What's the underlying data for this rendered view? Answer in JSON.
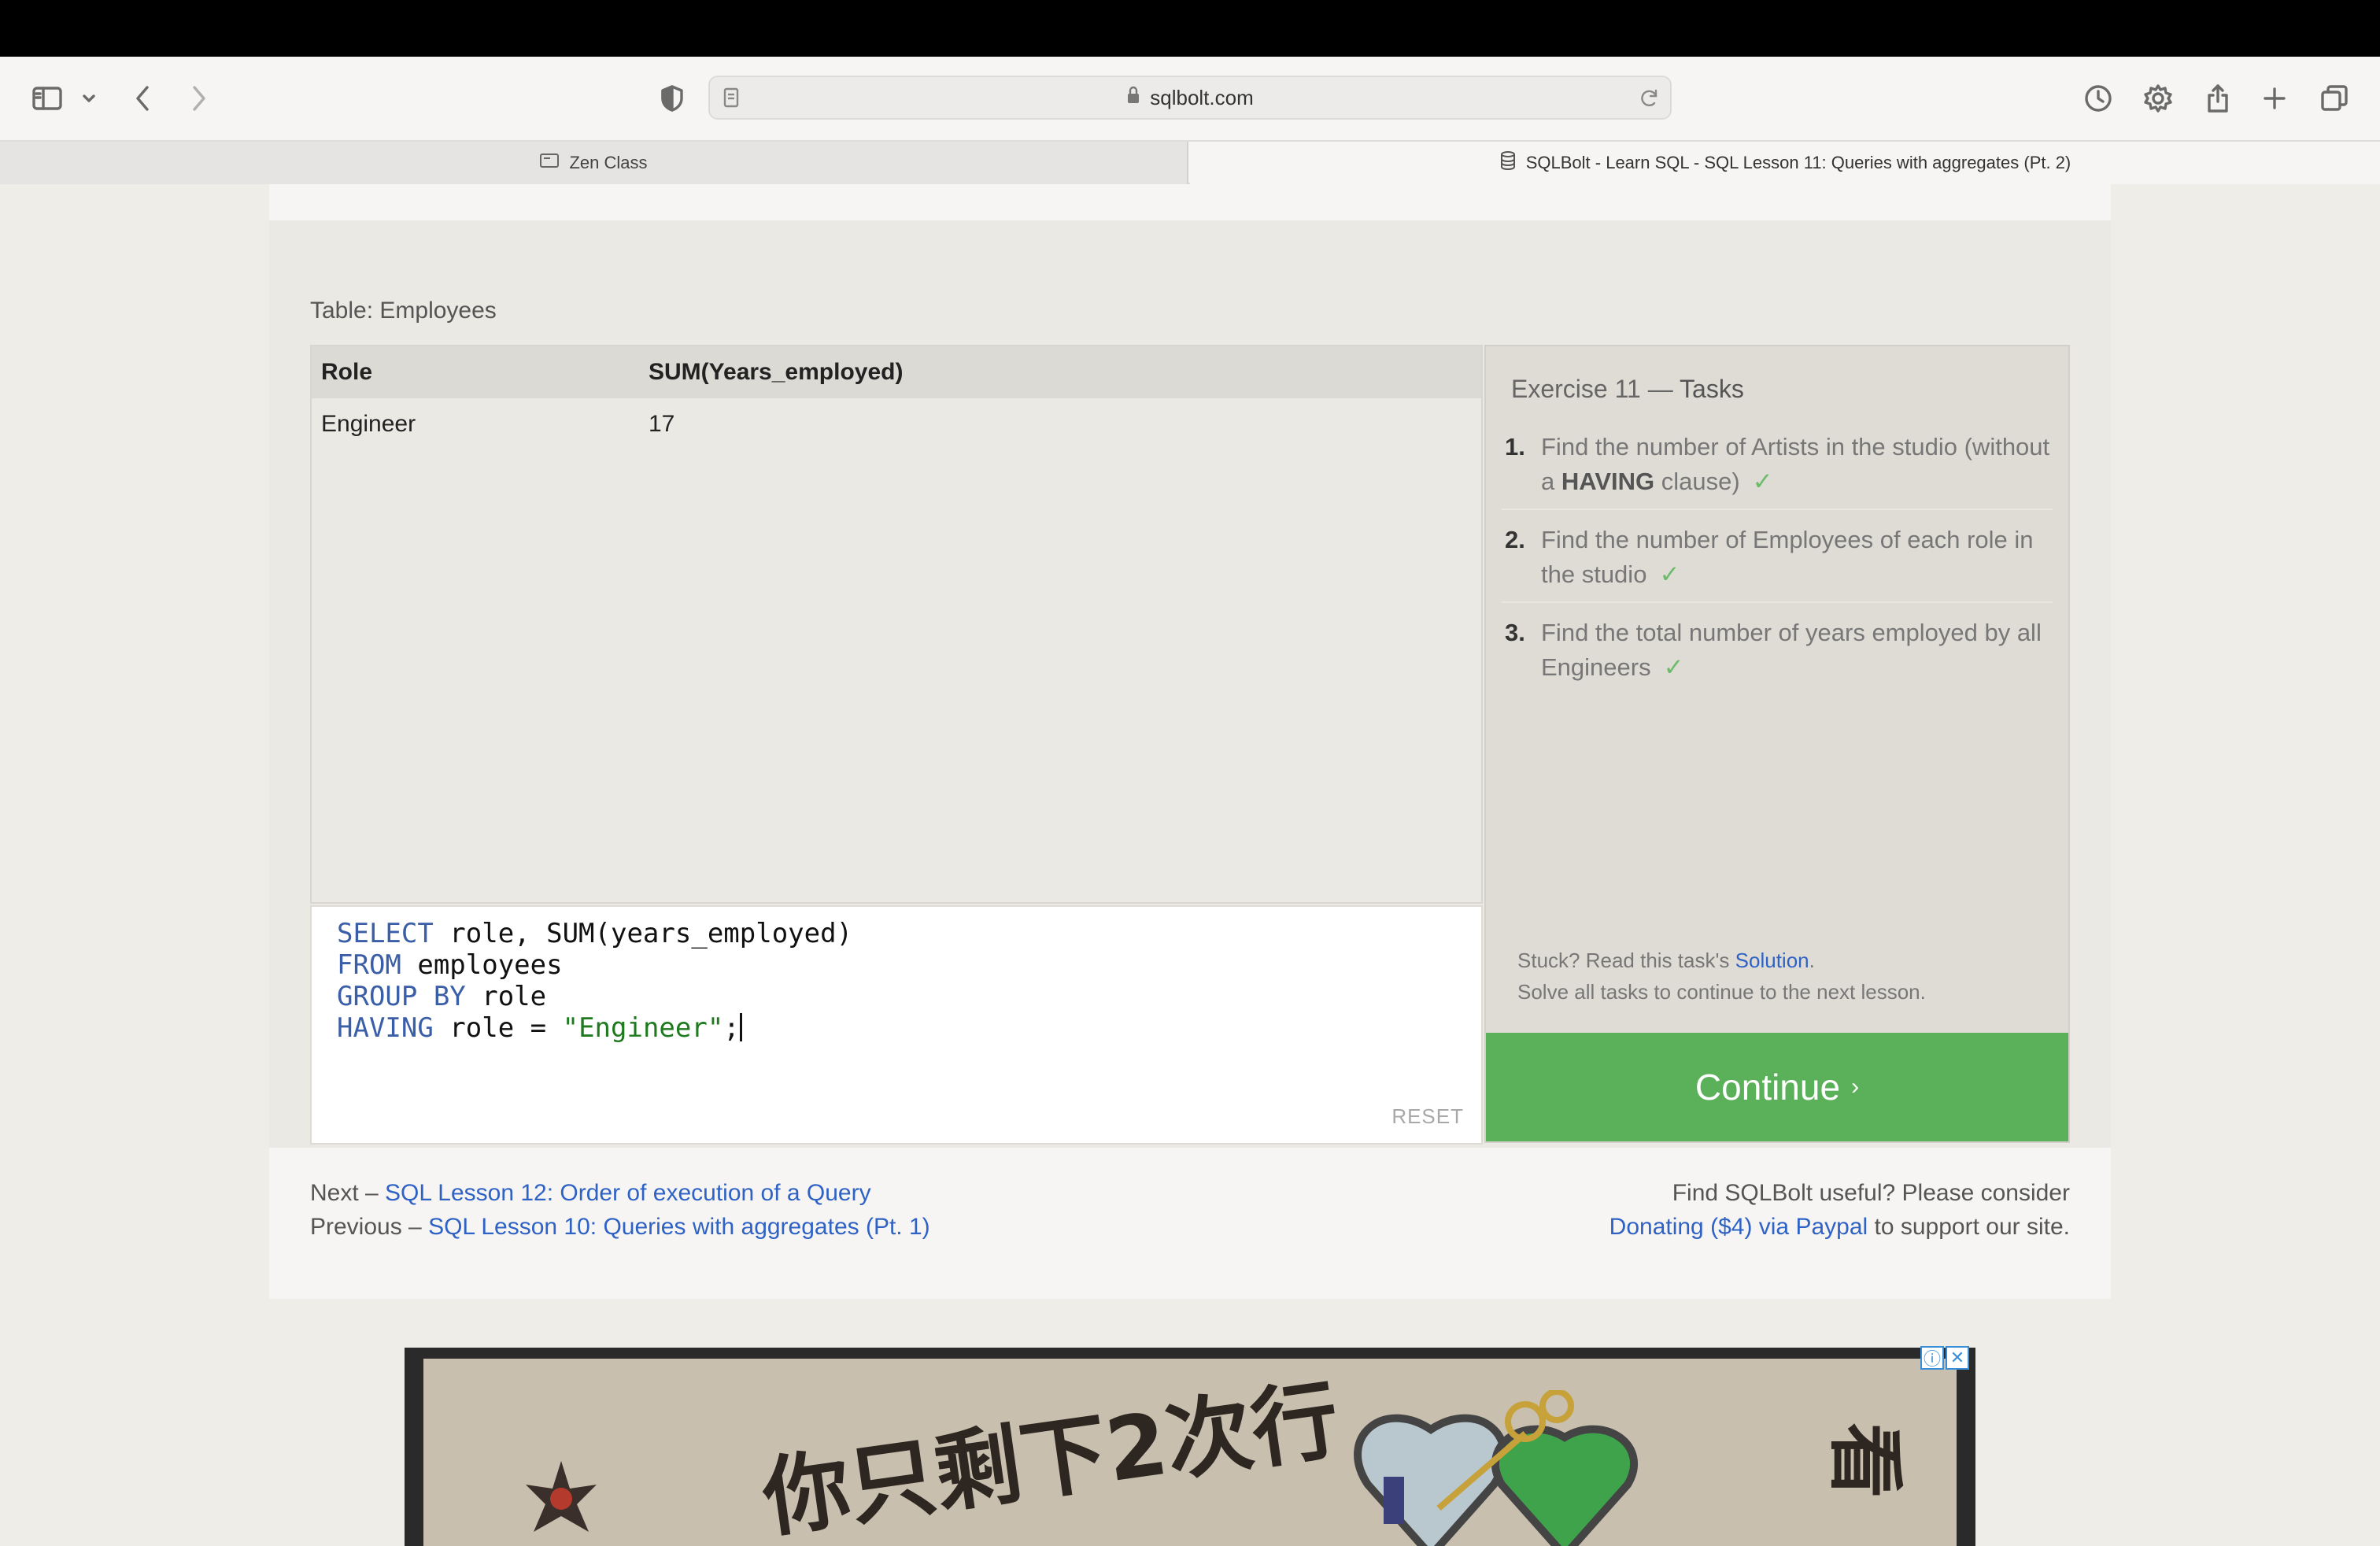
{
  "browser": {
    "url": "sqlbolt.com",
    "tabs": [
      {
        "label": "Zen Class",
        "active": false
      },
      {
        "label": "SQLBolt - Learn SQL - SQL Lesson 11: Queries with aggregates (Pt. 2)",
        "active": true
      }
    ]
  },
  "exercise": {
    "table_label": "Table: Employees",
    "columns": [
      "Role",
      "SUM(Years_employed)"
    ],
    "rows": [
      [
        "Engineer",
        "17"
      ]
    ],
    "query_lines": [
      {
        "kw": "SELECT",
        "rest": " role, SUM(years_employed)"
      },
      {
        "kw": "FROM",
        "rest": " employees"
      },
      {
        "kw": "GROUP BY",
        "rest": " role"
      },
      {
        "kw": "HAVING",
        "rest": " role = ",
        "str": "\"Engineer\"",
        "end": ";"
      }
    ],
    "reset_label": "RESET"
  },
  "tasks": {
    "title_prefix": "Exercise 11",
    "title_dash": " — ",
    "title_suffix": "Tasks",
    "items": [
      {
        "num": "1.",
        "text_a": "Find the number of Artists in the studio (without a ",
        "bold": "HAVING",
        "text_b": " clause)",
        "check": "✓"
      },
      {
        "num": "2.",
        "text_a": "Find the number of Employees of each role in the studio",
        "check": "✓"
      },
      {
        "num": "3.",
        "text_a": "Find the total number of years employed by all Engineers",
        "check": "✓"
      }
    ],
    "stuck_prefix": "Stuck? Read this task's ",
    "solution_link": "Solution",
    "stuck_suffix": ".",
    "solve_all": "Solve all tasks to continue to the next lesson.",
    "continue_label": "Continue",
    "continue_chevron": "›"
  },
  "footer": {
    "next_prefix": "Next – ",
    "next_link": "SQL Lesson 12: Order of execution of a Query",
    "prev_prefix": "Previous – ",
    "prev_link": "SQL Lesson 10: Queries with aggregates (Pt. 1)",
    "useful": "Find SQLBolt useful? Please consider",
    "donate_link": "Donating ($4) via Paypal",
    "donate_suffix": " to support our site."
  },
  "ad": {
    "headline": "你只剩下2次行",
    "side": "看",
    "info_icon": "ⓘ",
    "close_icon": "✕"
  },
  "colors": {
    "continue": "#5bb05a",
    "link": "#2f62c5",
    "keyword": "#3b5ea8",
    "string": "#1f7a1f",
    "check": "#6dbb6a"
  }
}
